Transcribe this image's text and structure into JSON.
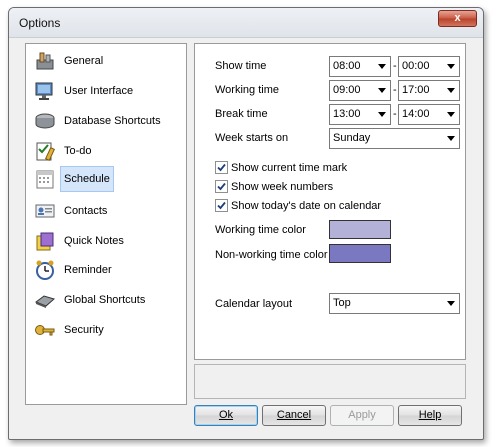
{
  "window": {
    "title": "Options",
    "close_glyph": "x"
  },
  "sidebar": {
    "items": [
      {
        "label": "General",
        "icon": "tools-icon"
      },
      {
        "label": "User Interface",
        "icon": "monitor-icon"
      },
      {
        "label": "Database Shortcuts",
        "icon": "database-icon"
      },
      {
        "label": "To-do",
        "icon": "checklist-icon"
      },
      {
        "label": "Schedule",
        "icon": "calendar-icon",
        "selected": true
      },
      {
        "label": "Contacts",
        "icon": "contact-card-icon"
      },
      {
        "label": "Quick Notes",
        "icon": "notes-icon"
      },
      {
        "label": "Reminder",
        "icon": "alarm-clock-icon"
      },
      {
        "label": "Global Shortcuts",
        "icon": "keyboard-icon"
      },
      {
        "label": "Security",
        "icon": "key-icon"
      }
    ]
  },
  "schedule": {
    "show_time": {
      "label": "Show time",
      "from": "08:00",
      "to": "00:00"
    },
    "working_time": {
      "label": "Working time",
      "from": "09:00",
      "to": "17:00"
    },
    "break_time": {
      "label": "Break time",
      "from": "13:00",
      "to": "14:00"
    },
    "week_starts": {
      "label": "Week starts on",
      "value": "Sunday"
    },
    "range_separator": "-",
    "checks": [
      {
        "label": "Show current time mark",
        "checked": true
      },
      {
        "label": "Show week numbers",
        "checked": true
      },
      {
        "label": "Show today's date on calendar",
        "checked": true
      }
    ],
    "working_color": {
      "label": "Working time color",
      "color": "#b4b1d9"
    },
    "nonworking_color": {
      "label": "Non-working time color",
      "color": "#7b78c2"
    },
    "calendar_layout": {
      "label": "Calendar layout",
      "value": "Top"
    }
  },
  "buttons": {
    "ok": "Ok",
    "cancel": "Cancel",
    "apply": "Apply",
    "help": "Help"
  }
}
